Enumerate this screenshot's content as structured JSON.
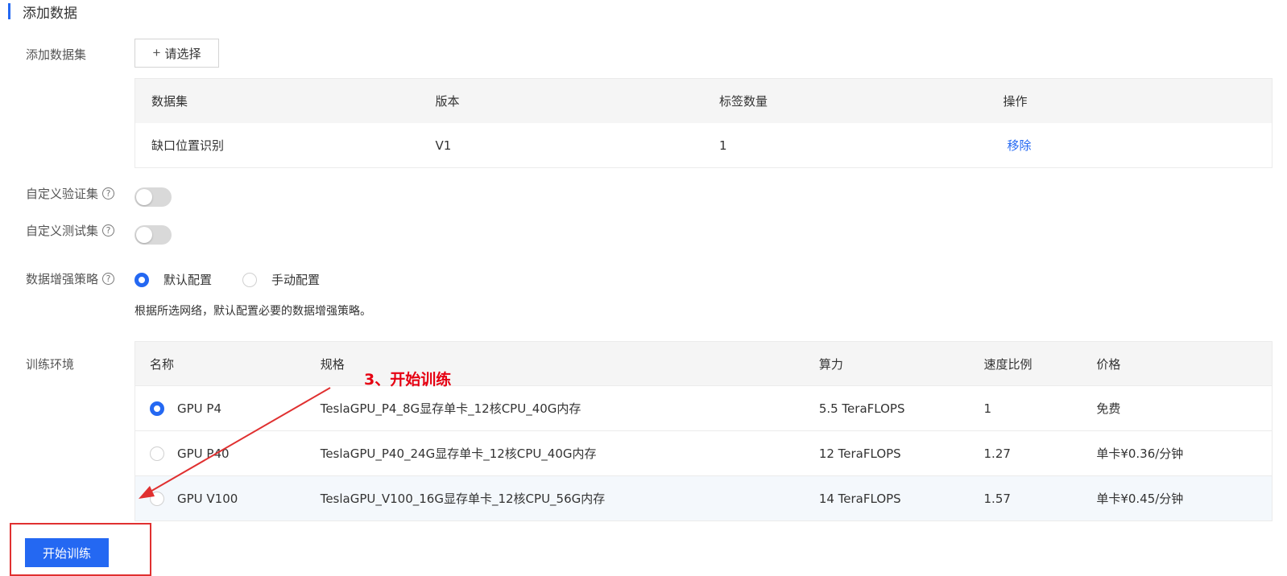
{
  "section": {
    "title": "添加数据"
  },
  "form": {
    "dataset_label": "添加数据集",
    "select_button": "请选择",
    "select_plus": "+",
    "validation_label": "自定义验证集",
    "test_label": "自定义测试集",
    "augment_label": "数据增强策略",
    "help_glyph": "?",
    "augment_options": [
      "默认配置",
      "手动配置"
    ],
    "augment_selected": "默认配置",
    "augment_hint": "根据所选网络，默认配置必要的数据增强策略。",
    "env_label": "训练环境",
    "validation_enabled": false,
    "test_enabled": false
  },
  "dataset_table": {
    "headers": [
      "数据集",
      "版本",
      "标签数量",
      "操作"
    ],
    "rows": [
      {
        "name": "缺口位置识别",
        "version": "V1",
        "labels": "1",
        "action": "移除"
      }
    ]
  },
  "env_table": {
    "headers": [
      "名称",
      "规格",
      "算力",
      "速度比例",
      "价格"
    ],
    "rows": [
      {
        "name": "GPU P4",
        "spec": "TeslaGPU_P4_8G显存单卡_12核CPU_40G内存",
        "power": "5.5 TeraFLOPS",
        "speed": "1",
        "price": "免费",
        "selected": true
      },
      {
        "name": "GPU P40",
        "spec": "TeslaGPU_P40_24G显存单卡_12核CPU_40G内存",
        "power": "12 TeraFLOPS",
        "speed": "1.27",
        "price": "单卡¥0.36/分钟",
        "selected": false
      },
      {
        "name": "GPU V100",
        "spec": "TeslaGPU_V100_16G显存单卡_12核CPU_56G内存",
        "power": "14 TeraFLOPS",
        "speed": "1.57",
        "price": "单卡¥0.45/分钟",
        "selected": false
      }
    ]
  },
  "annotation": {
    "text": "3、开始训练",
    "color": "#e60012"
  },
  "actions": {
    "start_button": "开始训练"
  },
  "colors": {
    "accent": "#2468f2",
    "annotation_red": "#e03030"
  }
}
